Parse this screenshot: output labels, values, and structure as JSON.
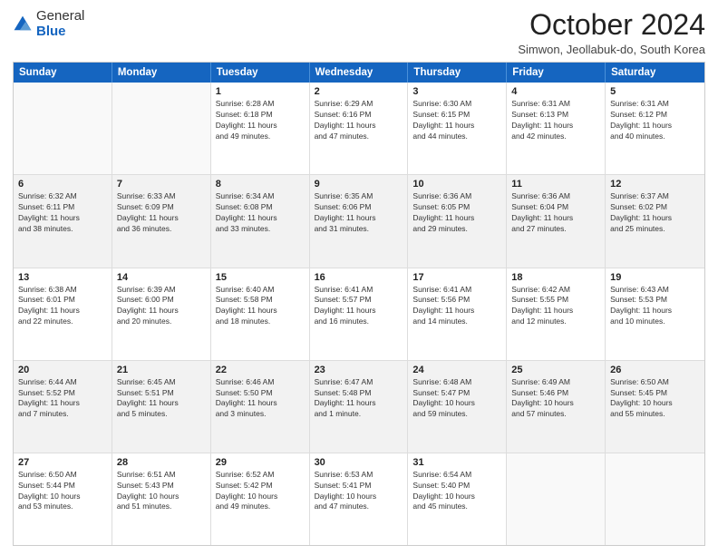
{
  "logo": {
    "general": "General",
    "blue": "Blue"
  },
  "title": "October 2024",
  "location": "Simwon, Jeollabuk-do, South Korea",
  "days_of_week": [
    "Sunday",
    "Monday",
    "Tuesday",
    "Wednesday",
    "Thursday",
    "Friday",
    "Saturday"
  ],
  "weeks": [
    [
      {
        "day": "",
        "empty": true,
        "lines": []
      },
      {
        "day": "",
        "empty": true,
        "lines": []
      },
      {
        "day": "1",
        "lines": [
          "Sunrise: 6:28 AM",
          "Sunset: 6:18 PM",
          "Daylight: 11 hours",
          "and 49 minutes."
        ]
      },
      {
        "day": "2",
        "lines": [
          "Sunrise: 6:29 AM",
          "Sunset: 6:16 PM",
          "Daylight: 11 hours",
          "and 47 minutes."
        ]
      },
      {
        "day": "3",
        "lines": [
          "Sunrise: 6:30 AM",
          "Sunset: 6:15 PM",
          "Daylight: 11 hours",
          "and 44 minutes."
        ]
      },
      {
        "day": "4",
        "lines": [
          "Sunrise: 6:31 AM",
          "Sunset: 6:13 PM",
          "Daylight: 11 hours",
          "and 42 minutes."
        ]
      },
      {
        "day": "5",
        "lines": [
          "Sunrise: 6:31 AM",
          "Sunset: 6:12 PM",
          "Daylight: 11 hours",
          "and 40 minutes."
        ]
      }
    ],
    [
      {
        "day": "6",
        "lines": [
          "Sunrise: 6:32 AM",
          "Sunset: 6:11 PM",
          "Daylight: 11 hours",
          "and 38 minutes."
        ]
      },
      {
        "day": "7",
        "lines": [
          "Sunrise: 6:33 AM",
          "Sunset: 6:09 PM",
          "Daylight: 11 hours",
          "and 36 minutes."
        ]
      },
      {
        "day": "8",
        "lines": [
          "Sunrise: 6:34 AM",
          "Sunset: 6:08 PM",
          "Daylight: 11 hours",
          "and 33 minutes."
        ]
      },
      {
        "day": "9",
        "lines": [
          "Sunrise: 6:35 AM",
          "Sunset: 6:06 PM",
          "Daylight: 11 hours",
          "and 31 minutes."
        ]
      },
      {
        "day": "10",
        "lines": [
          "Sunrise: 6:36 AM",
          "Sunset: 6:05 PM",
          "Daylight: 11 hours",
          "and 29 minutes."
        ]
      },
      {
        "day": "11",
        "lines": [
          "Sunrise: 6:36 AM",
          "Sunset: 6:04 PM",
          "Daylight: 11 hours",
          "and 27 minutes."
        ]
      },
      {
        "day": "12",
        "lines": [
          "Sunrise: 6:37 AM",
          "Sunset: 6:02 PM",
          "Daylight: 11 hours",
          "and 25 minutes."
        ]
      }
    ],
    [
      {
        "day": "13",
        "lines": [
          "Sunrise: 6:38 AM",
          "Sunset: 6:01 PM",
          "Daylight: 11 hours",
          "and 22 minutes."
        ]
      },
      {
        "day": "14",
        "lines": [
          "Sunrise: 6:39 AM",
          "Sunset: 6:00 PM",
          "Daylight: 11 hours",
          "and 20 minutes."
        ]
      },
      {
        "day": "15",
        "lines": [
          "Sunrise: 6:40 AM",
          "Sunset: 5:58 PM",
          "Daylight: 11 hours",
          "and 18 minutes."
        ]
      },
      {
        "day": "16",
        "lines": [
          "Sunrise: 6:41 AM",
          "Sunset: 5:57 PM",
          "Daylight: 11 hours",
          "and 16 minutes."
        ]
      },
      {
        "day": "17",
        "lines": [
          "Sunrise: 6:41 AM",
          "Sunset: 5:56 PM",
          "Daylight: 11 hours",
          "and 14 minutes."
        ]
      },
      {
        "day": "18",
        "lines": [
          "Sunrise: 6:42 AM",
          "Sunset: 5:55 PM",
          "Daylight: 11 hours",
          "and 12 minutes."
        ]
      },
      {
        "day": "19",
        "lines": [
          "Sunrise: 6:43 AM",
          "Sunset: 5:53 PM",
          "Daylight: 11 hours",
          "and 10 minutes."
        ]
      }
    ],
    [
      {
        "day": "20",
        "lines": [
          "Sunrise: 6:44 AM",
          "Sunset: 5:52 PM",
          "Daylight: 11 hours",
          "and 7 minutes."
        ]
      },
      {
        "day": "21",
        "lines": [
          "Sunrise: 6:45 AM",
          "Sunset: 5:51 PM",
          "Daylight: 11 hours",
          "and 5 minutes."
        ]
      },
      {
        "day": "22",
        "lines": [
          "Sunrise: 6:46 AM",
          "Sunset: 5:50 PM",
          "Daylight: 11 hours",
          "and 3 minutes."
        ]
      },
      {
        "day": "23",
        "lines": [
          "Sunrise: 6:47 AM",
          "Sunset: 5:48 PM",
          "Daylight: 11 hours",
          "and 1 minute."
        ]
      },
      {
        "day": "24",
        "lines": [
          "Sunrise: 6:48 AM",
          "Sunset: 5:47 PM",
          "Daylight: 10 hours",
          "and 59 minutes."
        ]
      },
      {
        "day": "25",
        "lines": [
          "Sunrise: 6:49 AM",
          "Sunset: 5:46 PM",
          "Daylight: 10 hours",
          "and 57 minutes."
        ]
      },
      {
        "day": "26",
        "lines": [
          "Sunrise: 6:50 AM",
          "Sunset: 5:45 PM",
          "Daylight: 10 hours",
          "and 55 minutes."
        ]
      }
    ],
    [
      {
        "day": "27",
        "lines": [
          "Sunrise: 6:50 AM",
          "Sunset: 5:44 PM",
          "Daylight: 10 hours",
          "and 53 minutes."
        ]
      },
      {
        "day": "28",
        "lines": [
          "Sunrise: 6:51 AM",
          "Sunset: 5:43 PM",
          "Daylight: 10 hours",
          "and 51 minutes."
        ]
      },
      {
        "day": "29",
        "lines": [
          "Sunrise: 6:52 AM",
          "Sunset: 5:42 PM",
          "Daylight: 10 hours",
          "and 49 minutes."
        ]
      },
      {
        "day": "30",
        "lines": [
          "Sunrise: 6:53 AM",
          "Sunset: 5:41 PM",
          "Daylight: 10 hours",
          "and 47 minutes."
        ]
      },
      {
        "day": "31",
        "lines": [
          "Sunrise: 6:54 AM",
          "Sunset: 5:40 PM",
          "Daylight: 10 hours",
          "and 45 minutes."
        ]
      },
      {
        "day": "",
        "empty": true,
        "lines": []
      },
      {
        "day": "",
        "empty": true,
        "lines": []
      }
    ]
  ]
}
